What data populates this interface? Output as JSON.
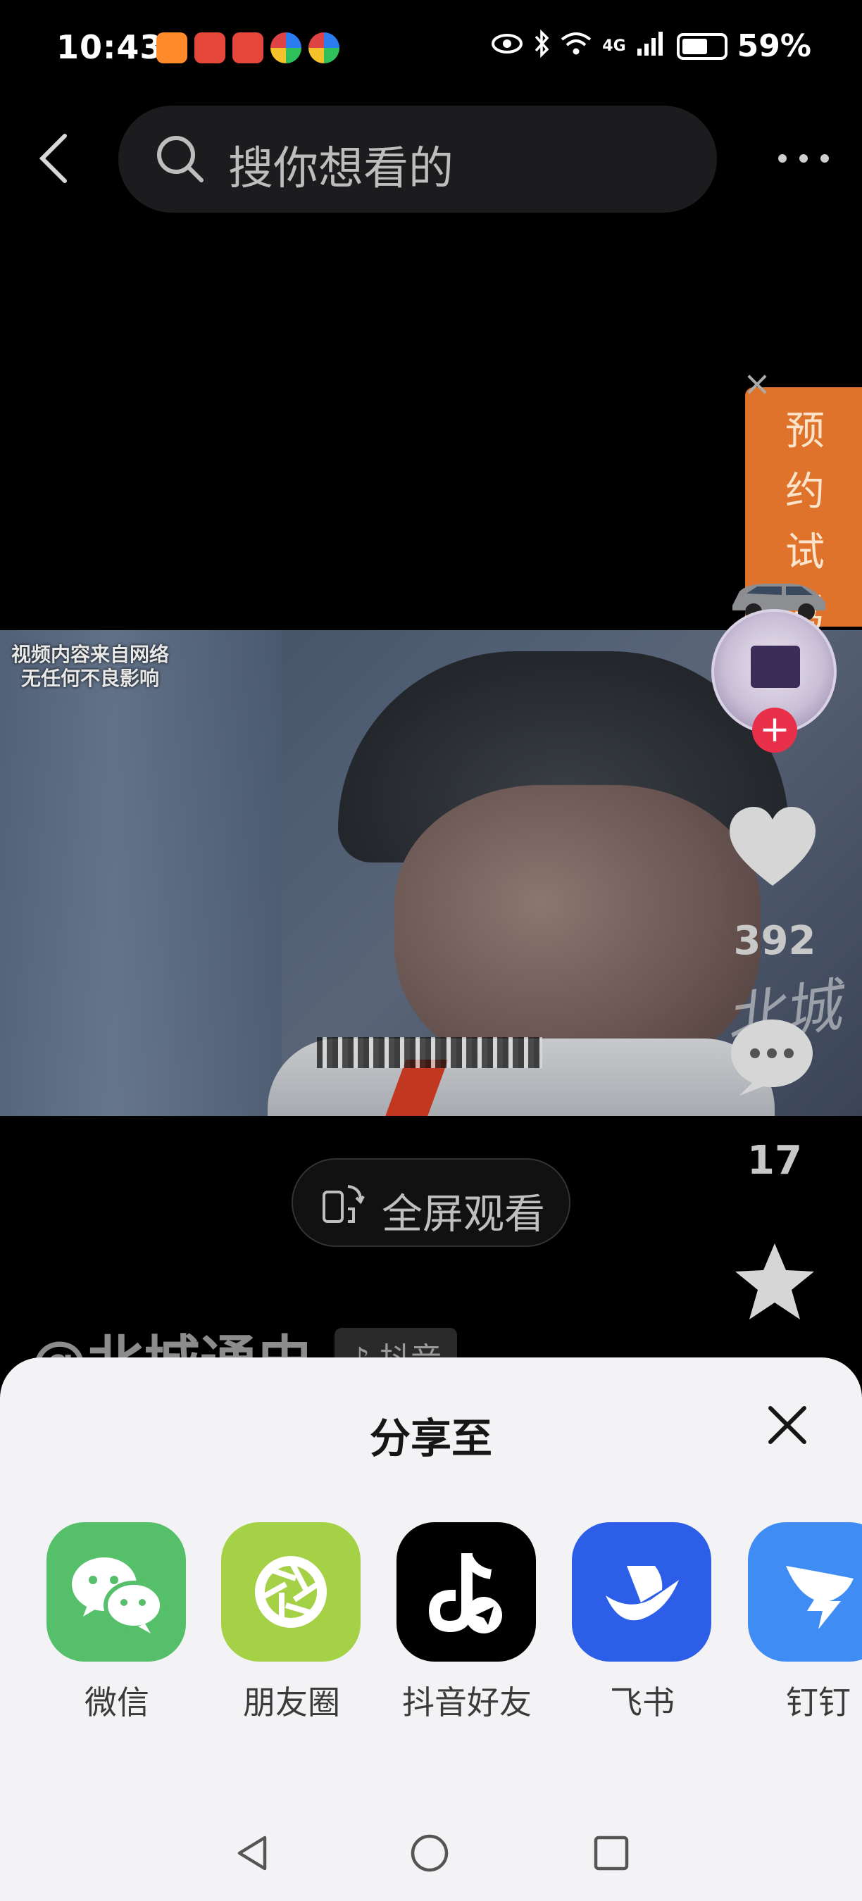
{
  "status_bar": {
    "time": "10:43",
    "battery": "59%",
    "network": "4G"
  },
  "search": {
    "placeholder": "搜你想看的"
  },
  "video": {
    "watermark_line1": "视频内容来自网络",
    "watermark_line2": "无任何不良影响"
  },
  "ad": {
    "label": "预约试驾"
  },
  "rail": {
    "like_count": "392",
    "comment_count": "17",
    "channel_stamp": "北城"
  },
  "fullscreen": {
    "label": "全屏观看"
  },
  "author": {
    "name": "@北城通史",
    "platform": "抖音"
  },
  "share_sheet": {
    "title": "分享至",
    "targets": [
      {
        "label": "微信",
        "icon": "wechat-icon"
      },
      {
        "label": "朋友圈",
        "icon": "moments-icon"
      },
      {
        "label": "抖音好友",
        "icon": "douyin-icon"
      },
      {
        "label": "飞书",
        "icon": "feishu-icon"
      },
      {
        "label": "钉钉",
        "icon": "dingtalk-icon"
      }
    ]
  },
  "colors": {
    "wechat": "#55bf6a",
    "moments": "#a5d147",
    "douyin": "#000000",
    "feishu": "#2d5ee8",
    "dingtalk": "#3f8df4",
    "ad": "#e0732b",
    "follow": "#e8304a"
  }
}
